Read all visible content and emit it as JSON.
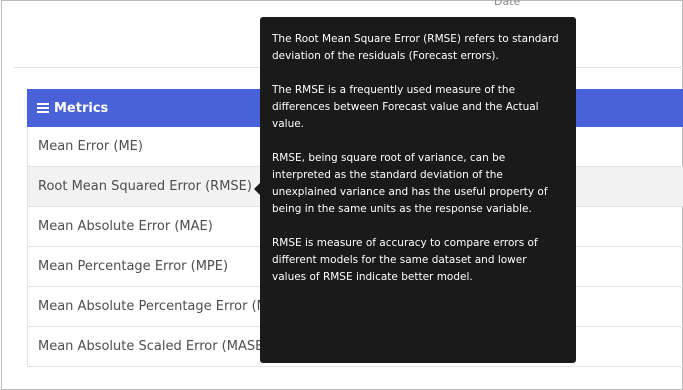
{
  "top_panel": {
    "axis_label_fragment": "Date"
  },
  "metrics": {
    "header": "Metrics",
    "items": [
      {
        "label": "Mean Error (ME)"
      },
      {
        "label": "Root Mean Squared Error (RMSE)"
      },
      {
        "label": "Mean Absolute Error (MAE)"
      },
      {
        "label": "Mean Percentage Error (MPE)"
      },
      {
        "label": "Mean Absolute Percentage Error (MAPE)"
      },
      {
        "label": "Mean Absolute Scaled Error (MASE)"
      }
    ],
    "active_index": 1
  },
  "tooltip": {
    "paragraphs": [
      "The Root Mean Square Error (RMSE) refers to standard deviation of the residuals (Forecast errors).",
      "The RMSE is a frequently used measure of the differences between Forecast value and the Actual value.",
      "RMSE, being square root of variance, can be interpreted as the standard deviation of the unexplained variance and has the useful property of being in the same units as the response variable.",
      "RMSE is measure of accuracy to compare errors of different models for the same dataset and lower values of RMSE indicate better model."
    ]
  },
  "colors": {
    "header_bg": "#4a62d8",
    "tooltip_bg": "#1a1a1a",
    "active_row_bg": "#f2f2f2"
  }
}
